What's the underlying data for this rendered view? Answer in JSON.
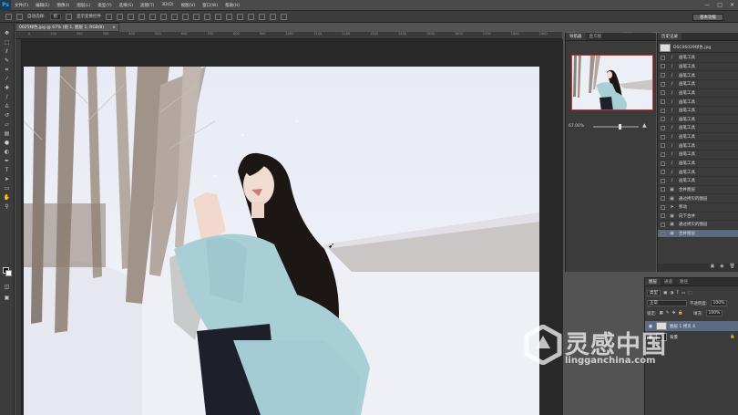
{
  "app": {
    "logo": "Ps"
  },
  "menu": [
    "文件(F)",
    "编辑(E)",
    "图像(I)",
    "图层(L)",
    "类型(Y)",
    "选择(S)",
    "滤镜(T)",
    "3D(D)",
    "视图(V)",
    "窗口(W)",
    "帮助(H)"
  ],
  "window_controls": [
    "—",
    "□",
    "✕"
  ],
  "options_bar": {
    "auto_select_label": "自动选择:",
    "auto_select_value": "组",
    "show_transform_label": "显示变换控件"
  },
  "workspace_button": "基本功能",
  "document_tab": {
    "title": "0025绿色.jpg @ 67% (组 1, 图层 1, RGB/8)",
    "close": "×"
  },
  "ruler_ticks": [
    "0",
    "100",
    "200",
    "300",
    "400",
    "500",
    "600",
    "700",
    "800",
    "900",
    "1000",
    "1100",
    "1200",
    "1300",
    "1400",
    "1500",
    "1600",
    "1700",
    "1800",
    "1900",
    "2000",
    "2100",
    "2200",
    "2300"
  ],
  "navigator": {
    "tabs": [
      "导航器",
      "直方图"
    ],
    "zoom": "67.00%",
    "zoom_fraction": 0.55
  },
  "history": {
    "tab": "历史记录",
    "snapshot": "DSC06029绿色.jpg",
    "items": [
      {
        "icon": "brush-icon",
        "label": "画笔工具"
      },
      {
        "icon": "brush-icon",
        "label": "画笔工具"
      },
      {
        "icon": "brush-icon",
        "label": "画笔工具"
      },
      {
        "icon": "brush-icon",
        "label": "画笔工具"
      },
      {
        "icon": "brush-icon",
        "label": "画笔工具"
      },
      {
        "icon": "brush-icon",
        "label": "画笔工具"
      },
      {
        "icon": "brush-icon",
        "label": "画笔工具"
      },
      {
        "icon": "brush-icon",
        "label": "画笔工具"
      },
      {
        "icon": "brush-icon",
        "label": "画笔工具"
      },
      {
        "icon": "brush-icon",
        "label": "画笔工具"
      },
      {
        "icon": "brush-icon",
        "label": "画笔工具"
      },
      {
        "icon": "brush-icon",
        "label": "画笔工具"
      },
      {
        "icon": "brush-icon",
        "label": "画笔工具"
      },
      {
        "icon": "brush-icon",
        "label": "画笔工具"
      },
      {
        "icon": "brush-icon",
        "label": "画笔工具"
      },
      {
        "icon": "layer-icon",
        "label": "合并图层"
      },
      {
        "icon": "layer-icon",
        "label": "通过拷贝的图层"
      },
      {
        "icon": "move-icon",
        "label": "移动"
      },
      {
        "icon": "layer-icon",
        "label": "向下合并"
      },
      {
        "icon": "layer-icon",
        "label": "通过拷贝的图层"
      },
      {
        "icon": "layer-icon",
        "label": "合并图层"
      }
    ]
  },
  "layers": {
    "tabs": [
      "图层",
      "通道",
      "路径"
    ],
    "kind": "类型",
    "blend": "正常",
    "opacity_label": "不透明度:",
    "opacity": "100%",
    "lock_label": "锁定:",
    "fill_label": "填充:",
    "fill": "100%",
    "items": [
      {
        "name": "图层 1 拷贝 4"
      },
      {
        "name": "背景"
      }
    ]
  },
  "watermark": {
    "cn": "灵感中国",
    "url": "lingganchina.com"
  }
}
